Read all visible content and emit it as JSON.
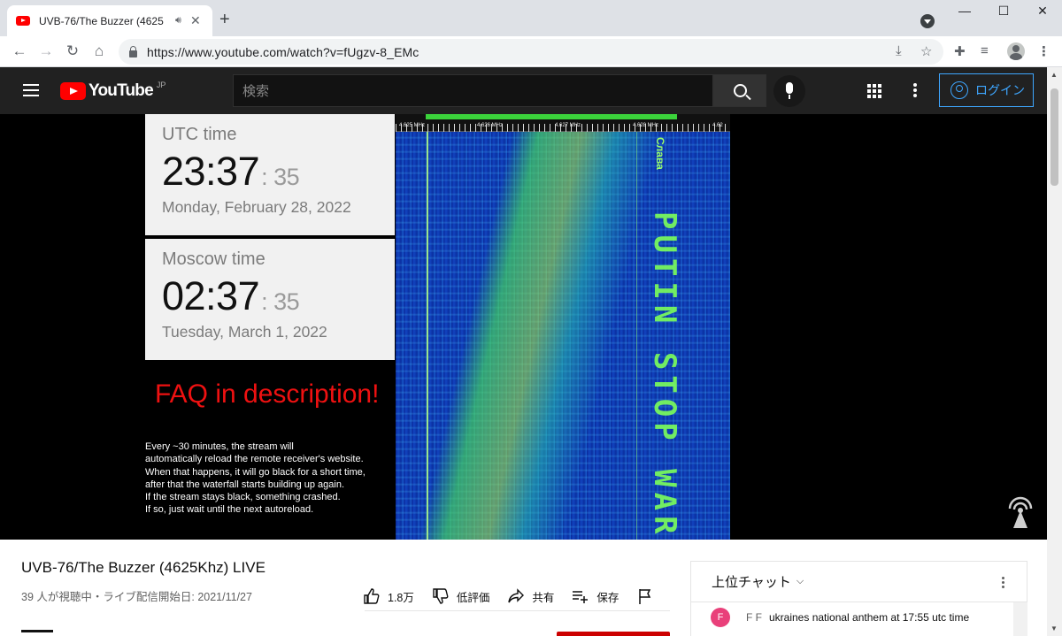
{
  "browser": {
    "tab_title": "UVB-76/The Buzzer (4625",
    "url": "https://www.youtube.com/watch?v=fUgzv-8_EMc"
  },
  "masthead": {
    "logo_text": "YouTube",
    "region": "JP",
    "search_placeholder": "検索",
    "login_label": "ログイン"
  },
  "video": {
    "utc": {
      "label": "UTC time",
      "time": "23:37",
      "seconds": ": 35",
      "date": "Monday, February 28, 2022"
    },
    "moscow": {
      "label": "Moscow time",
      "time": "02:37",
      "seconds": ": 35",
      "date": "Tuesday, March 1, 2022"
    },
    "faq_text": "FAQ in description!",
    "note_lines": [
      "Every ~30 minutes, the stream will",
      "automatically reload the remote receiver's website.",
      "When that happens, it will go black for a short time,",
      "after that the waterfall starts building up again.",
      "If the stream stays black, something crashed.",
      "If so, just wait until the next autoreload."
    ],
    "waterfall_text": "PUTIN STOP WAR",
    "waterfall_top_text": "Слава",
    "freq_labels": [
      "4.625 MHz",
      "4.626 MHz",
      "4.627 MHz",
      "4.628 MHz",
      "4.62"
    ]
  },
  "info": {
    "title": "UVB-76/The Buzzer (4625Khz) LIVE",
    "meta": "39 人が視聴中・ライブ配信開始日: 2021/11/27",
    "like_count": "1.8万",
    "dislike_label": "低評価",
    "share_label": "共有",
    "save_label": "保存"
  },
  "chat": {
    "header": "上位チャット",
    "message": {
      "avatar_letter": "F",
      "author": "F F",
      "text": "ukraines national anthem at 17:55 utc time"
    }
  },
  "colors": {
    "yt_red": "#ff0000",
    "link_blue": "#3ea6ff",
    "waterfall_green": "#7cff5a"
  }
}
